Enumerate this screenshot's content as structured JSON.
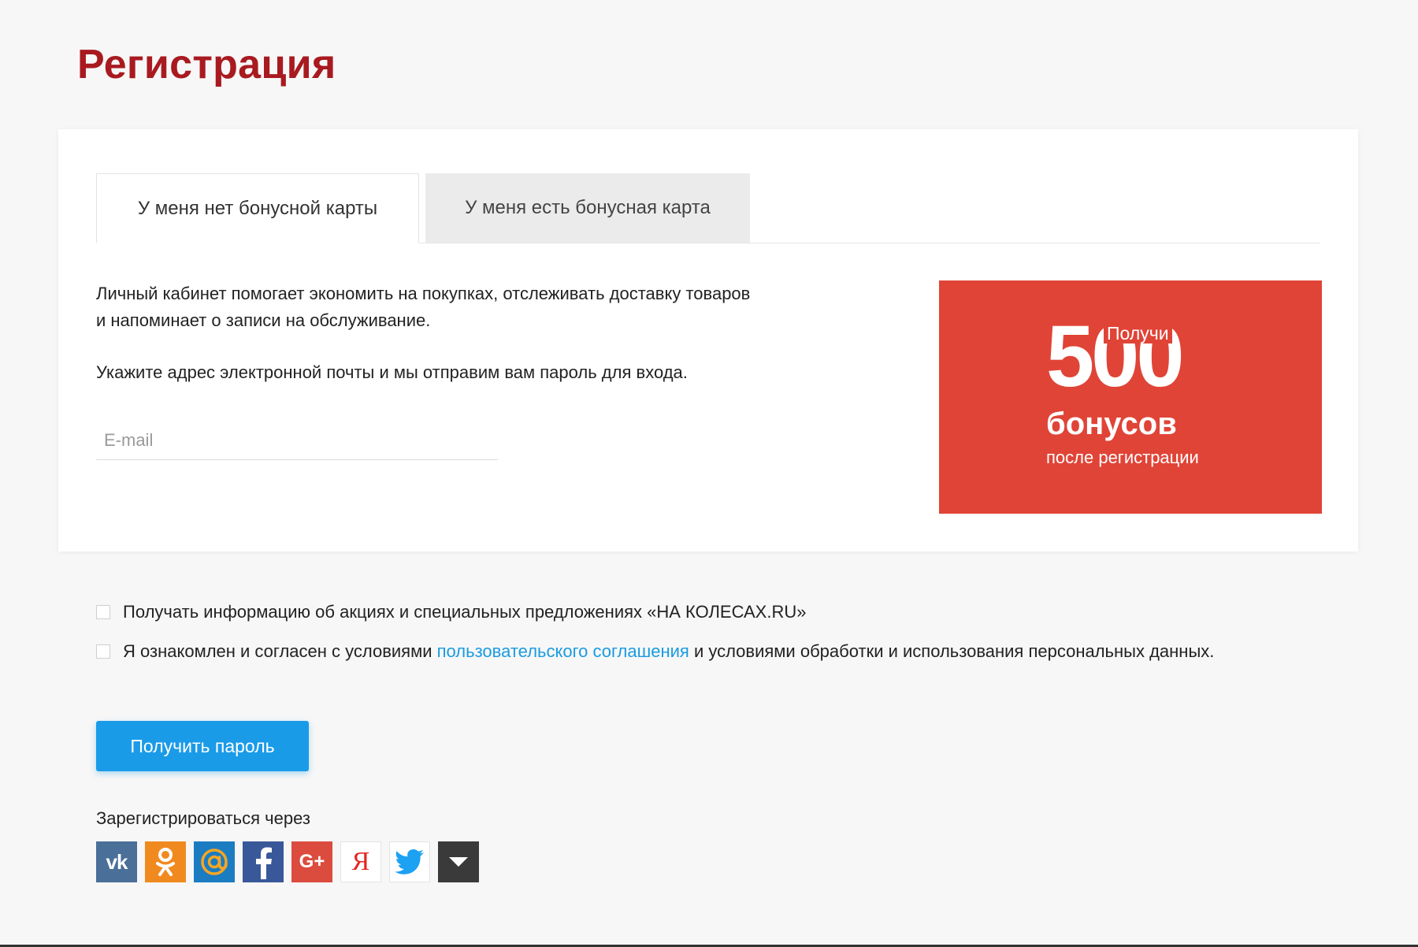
{
  "page": {
    "title": "Регистрация"
  },
  "tabs": [
    {
      "label": "У меня нет бонусной карты",
      "active": true
    },
    {
      "label": "У меня есть бонусная карта",
      "active": false
    }
  ],
  "form": {
    "intro_line1": "Личный кабинет помогает экономить на покупках, отслеживать доставку товаров",
    "intro_line2": "и напоминает о записи на обслуживание.",
    "instruction": "Укажите адрес электронной почты и мы отправим вам пароль для входа.",
    "email_placeholder": "E-mail",
    "email_value": ""
  },
  "promo": {
    "amount": "500",
    "get_label": "Получи",
    "bonus_label": "бонусов",
    "after_label": "после регистрации",
    "background": "#e04437"
  },
  "consents": {
    "newsletter": {
      "checked": false,
      "label": "Получать информацию об акциях и специальных предложениях «НА КОЛЕСАХ.RU»"
    },
    "agreement": {
      "checked": false,
      "before_link": "Я ознакомлен и согласен с условиями ",
      "link_text": "пользовательского соглашения",
      "after_link": " и условиями обработки и использования персональных данных."
    }
  },
  "submit": {
    "label": "Получить пароль",
    "color": "#1a9be8"
  },
  "social": {
    "label": "Зарегистрироваться через",
    "providers": [
      {
        "name": "vk",
        "icon": "vk-icon",
        "color": "#4a6f99"
      },
      {
        "name": "odnoklassniki",
        "icon": "odnoklassniki-icon",
        "color": "#f08a1f"
      },
      {
        "name": "mail",
        "icon": "at-sign-icon",
        "color": "#1b7cc2"
      },
      {
        "name": "facebook",
        "icon": "facebook-icon",
        "color": "#395899"
      },
      {
        "name": "google-plus",
        "icon": "google-plus-icon",
        "color": "#dc4c3e"
      },
      {
        "name": "yandex",
        "icon": "yandex-icon",
        "color": "#e52620"
      },
      {
        "name": "twitter",
        "icon": "twitter-icon",
        "color": "#1da1f2"
      },
      {
        "name": "more",
        "icon": "chevron-down-icon",
        "color": "#3a3a3a"
      }
    ],
    "glyphs": {
      "vk": "vk",
      "google_plus": "G+",
      "yandex": "Я"
    }
  },
  "colors": {
    "title": "#a81a20",
    "link": "#1a9be0",
    "background": "#f7f7f7"
  }
}
